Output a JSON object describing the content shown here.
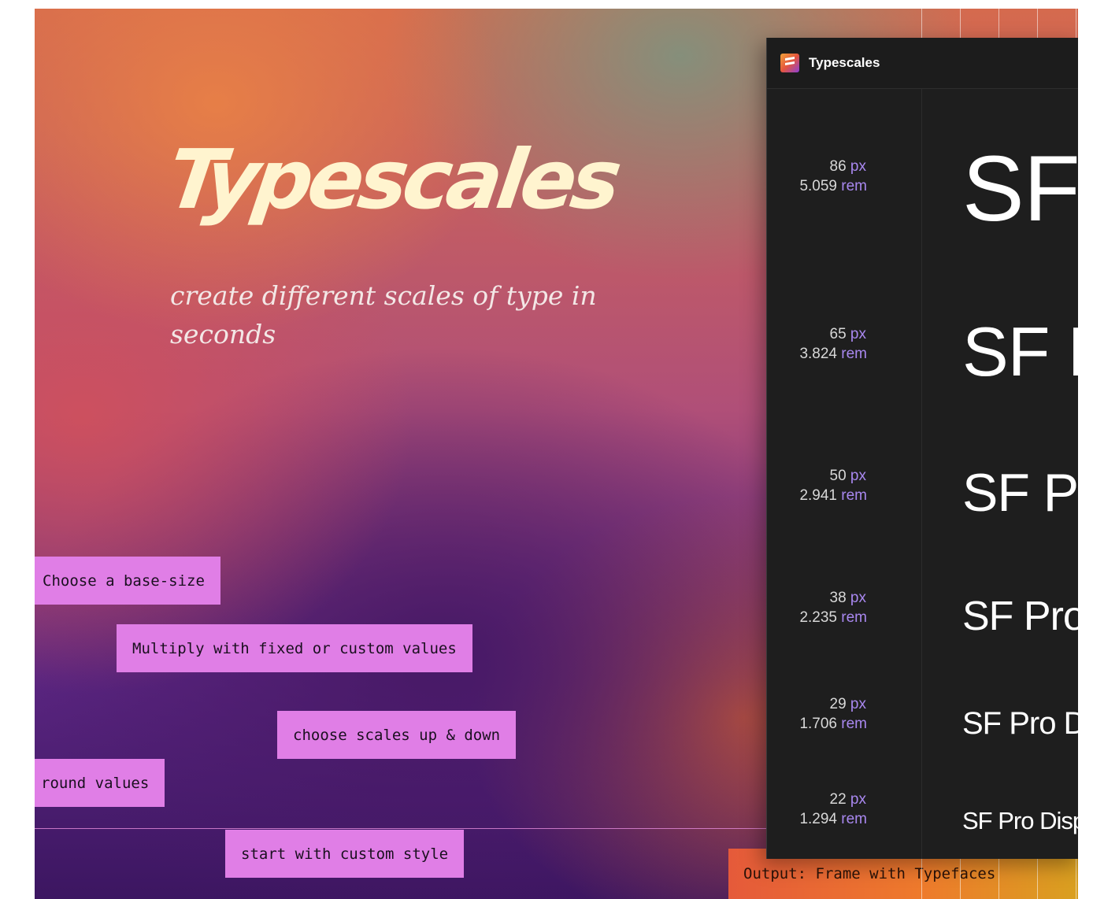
{
  "hero": {
    "title": "Typescales",
    "subtitle": "create different scales of type in seconds"
  },
  "tags": [
    "Choose a base-size",
    "Multiply with fixed or custom values",
    "choose scales up & down",
    "round values",
    "start with custom style"
  ],
  "output_tag": "Output: Frame with Typefaces",
  "panel": {
    "title": "Typescales",
    "icon": "typescales-plugin-icon",
    "px_unit": "px",
    "rem_unit": "rem",
    "rows": [
      {
        "px": "86",
        "rem": "5.059",
        "sample": "SF"
      },
      {
        "px": "65",
        "rem": "3.824",
        "sample": "SF F"
      },
      {
        "px": "50",
        "rem": "2.941",
        "sample": "SF Pr"
      },
      {
        "px": "38",
        "rem": "2.235",
        "sample": "SF Pro"
      },
      {
        "px": "29",
        "rem": "1.706",
        "sample": "SF Pro D"
      },
      {
        "px": "22",
        "rem": "1.294",
        "sample": "SF Pro Disp"
      }
    ]
  }
}
